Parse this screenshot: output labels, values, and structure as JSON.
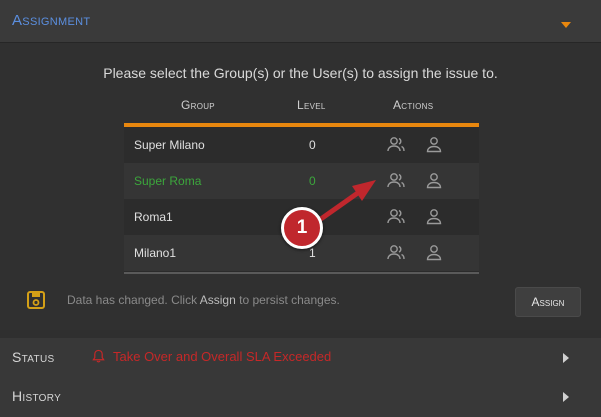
{
  "assignment": {
    "title": "Assignment"
  },
  "intro_text": "Please select the Group(s) or the User(s) to assign the issue to.",
  "columns": {
    "group": "Group",
    "level": "Level",
    "actions": "Actions"
  },
  "rows": [
    {
      "group": "Super Milano",
      "level": "0"
    },
    {
      "group": "Super Roma",
      "level": "0",
      "highlighted": true
    },
    {
      "group": "Roma1",
      "level": ""
    },
    {
      "group": "Milano1",
      "level": "1"
    }
  ],
  "changed": {
    "prefix": "Data has changed. Click ",
    "action": "Assign",
    "suffix": " to persist changes."
  },
  "assign_button": "Assign",
  "status": {
    "title": "Status",
    "sla_text": "Take Over and Overall SLA Exceeded"
  },
  "history": {
    "title": "History"
  },
  "callout_number": "1",
  "colors": {
    "accent": "#e8870e",
    "link_blue": "#5b8fe0",
    "highlight_green": "#3ca63c",
    "alert_red": "#c62828",
    "badge_red": "#c0272d"
  },
  "icons": [
    "caret-down-icon",
    "users-group-icon",
    "user-icon",
    "save-icon",
    "bell-icon",
    "caret-right-icon"
  ]
}
